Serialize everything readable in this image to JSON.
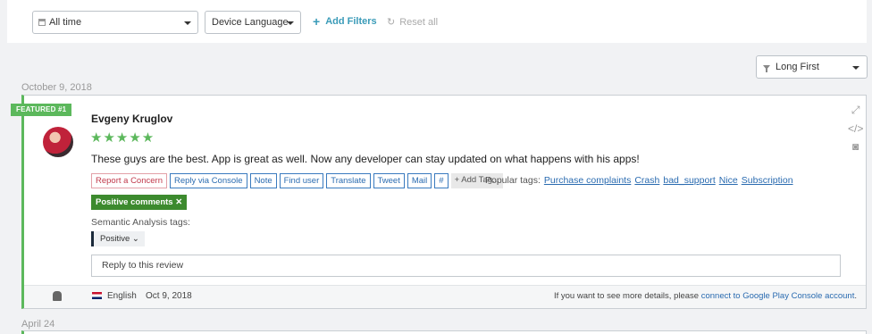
{
  "filters": {
    "time_range": "All time",
    "language": "Device Language",
    "add_filters": "Add Filters",
    "reset_all": "Reset all"
  },
  "sort": {
    "value": "Long First"
  },
  "groups": [
    {
      "date": "October 9, 2018"
    },
    {
      "date": "April 24"
    }
  ],
  "review": {
    "badge": "FEATURED #1",
    "author": "Evgeny Kruglov",
    "rating": 5,
    "stars": "★★★★★",
    "text": "These guys are the best. App is great as well. Now any developer can stay updated on what happens with his apps!",
    "actions": [
      "Report a Concern",
      "Reply via Console",
      "Note",
      "Find user",
      "Translate",
      "Tweet",
      "Mail",
      "#"
    ],
    "add_tag": "Add Tag...",
    "popular_label": "Popular tags:",
    "popular_tags": [
      "Purchase complaints",
      "Crash",
      "bad_support",
      "Nice",
      "Subscription"
    ],
    "applied_tag": "Positive comments",
    "semantic_label": "Semantic Analysis tags:",
    "semantic_value": "Positive",
    "reply_placeholder": "Reply to this review",
    "language": "English",
    "date": "Oct 9, 2018",
    "console_prefix": "If you want to see more details, please",
    "console_link": "connect to Google Play Console account",
    "console_suffix": "."
  },
  "colors": {
    "accent": "#5cb85c",
    "link": "#2a6bb0",
    "tag_green": "#3c8a2e"
  }
}
